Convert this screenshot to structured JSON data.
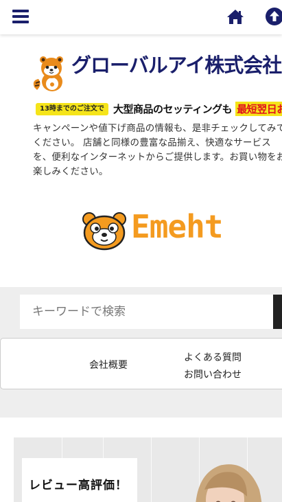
{
  "header": {
    "menu_icon": "hamburger-menu-icon",
    "home_icon": "home-icon",
    "scroll_top_icon": "arrow-up-circle-icon",
    "accent_color": "#1a1f6b"
  },
  "brand": {
    "company_name": "グローバルアイ株式会社",
    "banner_badge": "13時までのご注文で",
    "banner_text": "大型商品のセッティングも",
    "banner_highlight": "最短翌日お届け",
    "description": "キャンペーンや値下げ商品の情報も、是非チェックしてみてください。 店舗と同様の豊富な品揃え、快適なサービスを、便利なインターネットからご提供します。お買い物をお楽しみください。",
    "logo_text": "Emeht",
    "logo_color": "#f49b20"
  },
  "search": {
    "placeholder": "キーワードで検索"
  },
  "nav": {
    "company_label": "会社概要",
    "faq_label": "よくある質問",
    "contact_label": "お問い合わせ"
  },
  "hero": {
    "label": "レビュー高評価！"
  }
}
